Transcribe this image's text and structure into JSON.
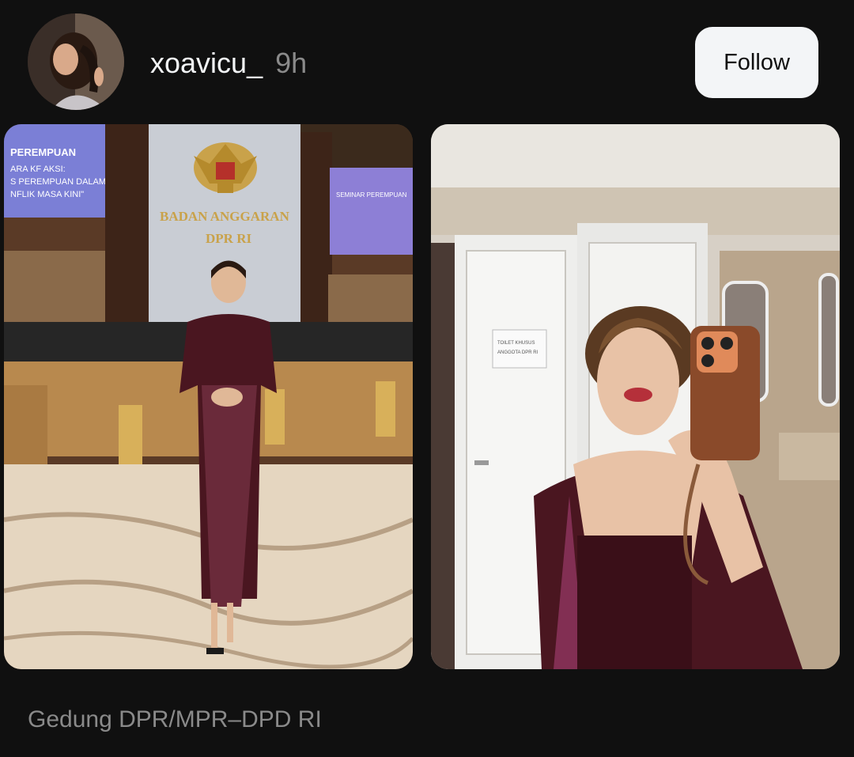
{
  "header": {
    "username": "xoavicu_",
    "time_ago": "9h",
    "follow_label": "Follow"
  },
  "media": {
    "photo_1": {
      "screen_left_lines": [
        "PEREMPUAN",
        "ARA KF AKSI:",
        "S PEREMPUAN DALAM",
        "NFLIK MASA KINI\""
      ],
      "wall_sign_lines": [
        "BADAN ANGGARAN",
        "DPR RI"
      ],
      "screen_right_lines": [
        "SEMINAR PEREMPUAN"
      ]
    },
    "photo_2": {
      "door_sign_lines": [
        "TOILET KHUSUS",
        "ANGGOTA DPR RI"
      ]
    }
  },
  "location": "Gedung DPR/MPR–DPD RI",
  "colors": {
    "background": "#101010",
    "text_primary": "#f3f5f7",
    "text_secondary": "#8a8a8a",
    "button_bg": "#f3f5f7",
    "dress": "#4a1620"
  }
}
